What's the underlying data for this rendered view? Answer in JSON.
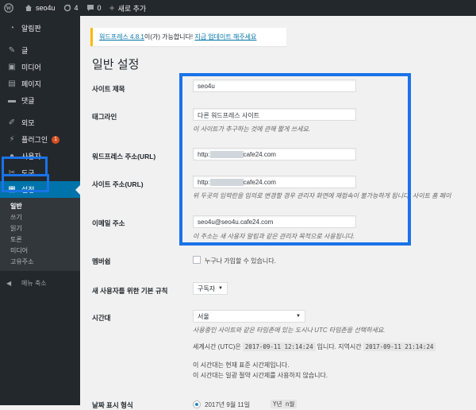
{
  "adminbar": {
    "site_name": "seo4u",
    "updates_count": "4",
    "comments_count": "0",
    "new_label": "새로 추가"
  },
  "sidebar": {
    "items": [
      {
        "label": "알림판",
        "icon": "dashboard-icon"
      },
      {
        "label": "글",
        "icon": "pin-icon"
      },
      {
        "label": "미디어",
        "icon": "media-icon"
      },
      {
        "label": "페이지",
        "icon": "page-icon"
      },
      {
        "label": "댓글",
        "icon": "comment-icon"
      },
      {
        "label": "외모",
        "icon": "brush-icon"
      },
      {
        "label": "플러그인",
        "icon": "plugin-icon",
        "badge": "1"
      },
      {
        "label": "사용자",
        "icon": "user-icon"
      },
      {
        "label": "도구",
        "icon": "wrench-icon"
      },
      {
        "label": "설정",
        "icon": "settings-icon"
      }
    ],
    "submenu": [
      "일반",
      "쓰기",
      "읽기",
      "토론",
      "미디어",
      "고유주소"
    ],
    "collapse_label": "메뉴 축소"
  },
  "notice": {
    "link_version": "워드프레스 4.8.1",
    "middle": "이(가) 가능합니다!",
    "link_update": "지금 업데이트 해주세요"
  },
  "page_title": "일반 설정",
  "fields": {
    "site_title_label": "사이트 제목",
    "site_title_value": "seo4u",
    "tagline_label": "태그라인",
    "tagline_value": "다른 워드프레스 사이트",
    "tagline_desc": "이 사이트가 추구하는 것에 관해 짧게 쓰세요.",
    "wp_url_label": "워드프레스 주소(URL)",
    "wp_url_prefix": "http:",
    "wp_url_suffix": "cafe24.com",
    "site_url_label": "사이트 주소(URL)",
    "site_url_prefix": "http:",
    "site_url_suffix": "cafe24.com",
    "site_url_desc": "위 두곳의 입력란을 임의로 변경할 경우 관리자 화면에 재접속이 불가능하게 됩니다. 사이트 홈 페이",
    "email_label": "이메일 주소",
    "email_value": "seo4u@seo4u.cafe24.com",
    "email_desc": "이 주소는 새 사용자 알림과 같은 관리자 목적으로 사용됩니다.",
    "membership_label": "멤버쉽",
    "membership_text": "누구나 가입할 수 있습니다.",
    "default_role_label": "새 사용자를 위한 기본 규칙",
    "default_role_value": "구독자",
    "timezone_label": "시간대",
    "timezone_value": "서울",
    "timezone_desc": "사용중인 사이트와 같은 타임존에 있는 도시나 UTC 타임존을 선택하세요.",
    "utc_label": "세계시간 (UTC)은",
    "utc_time": "2017-09-11 12:14:24",
    "local_label": "입니다. 지역시간",
    "local_time": "2017-09-11 21:14:24",
    "std_time_note": "이 시간대는 현재 표준 시간제입니다.",
    "dst_note": "이 시간대는 일광 절약 시간제를 사용하지 않습니다.",
    "date_format_label": "날짜 표시 형식",
    "date_format_value": "2017년 9월 11일",
    "date_format_code": "Y년 n월"
  },
  "colors": {
    "highlight": "#1a73e8",
    "wp_blue": "#0073aa",
    "sidebar_bg": "#23282d"
  }
}
